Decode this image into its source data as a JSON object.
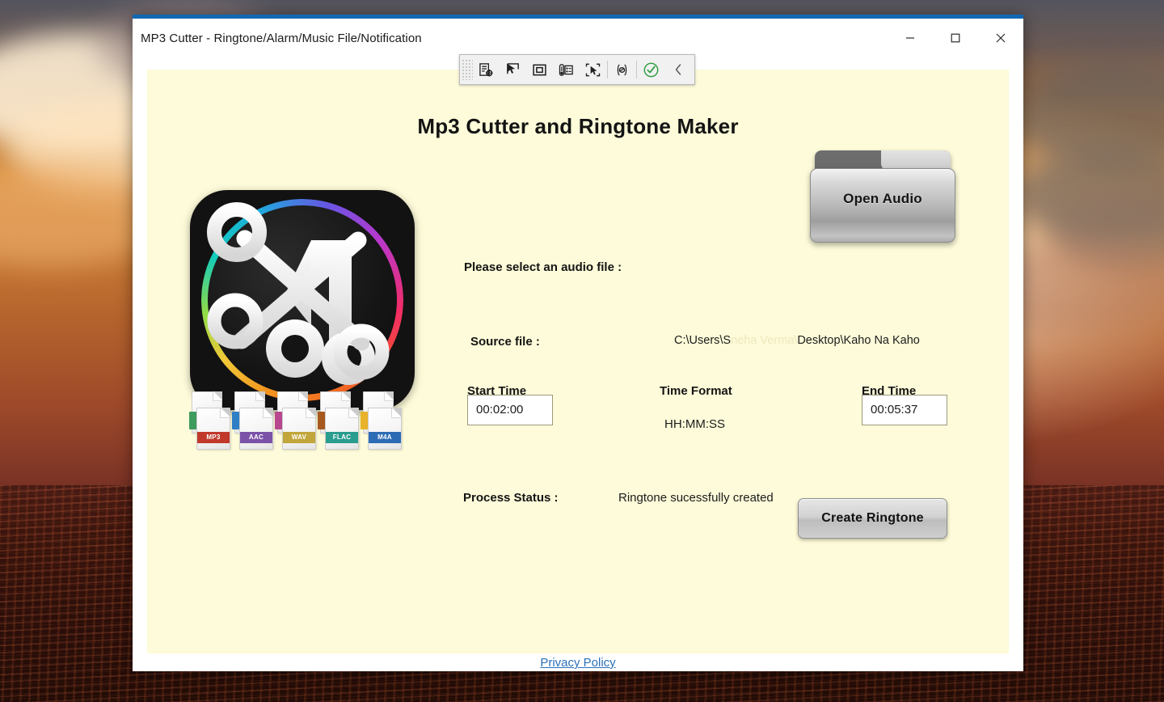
{
  "window": {
    "title": "MP3 Cutter  - Ringtone/Alarm/Music File/Notification",
    "accent_color": "#1268b3",
    "content_bg": "#fdfbd9",
    "controls": {
      "minimize": "Minimize",
      "maximize": "Maximize",
      "close": "Close"
    }
  },
  "dev_toolbar": {
    "items": [
      {
        "name": "drag-grip",
        "label": "Drag handle"
      },
      {
        "name": "inspect-element-icon",
        "label": "Inspect element"
      },
      {
        "name": "pointer-select-icon",
        "label": "Select control"
      },
      {
        "name": "frame-box-icon",
        "label": "Highlight frame"
      },
      {
        "name": "properties-panel-icon",
        "label": "Properties"
      },
      {
        "name": "capture-region-icon",
        "label": "Capture region"
      },
      {
        "name": "code-snippet-icon",
        "label": "{e}"
      },
      {
        "name": "validate-check-icon",
        "label": "Validate"
      },
      {
        "name": "collapse-chevron-icon",
        "label": "Collapse"
      }
    ],
    "check_color": "#2e9c3e"
  },
  "main": {
    "app_title": "Mp3 Cutter and Ringtone Maker",
    "select_prompt": "Please select an audio file :",
    "open_audio_label": "Open Audio",
    "source_label": "Source file :",
    "source_path_prefix": "C:\\Users\\S",
    "source_path_masked": "neha Verma\\",
    "source_path_suffix": "Desktop\\Kaho Na Kaho",
    "start_time_label": "Start Time",
    "start_time_value": "00:02:00",
    "time_format_label": "Time Format",
    "time_format_value": "HH:MM:SS",
    "end_time_label": "End Time",
    "end_time_value": "00:05:37",
    "process_status_label": "Process Status :",
    "process_status_value": "Ringtone sucessfully created",
    "create_button_label": "Create Ringtone",
    "privacy_link_label": " Privacy Policy"
  },
  "format_icons": [
    {
      "ext": "MP3",
      "color": "#c0392b",
      "tab_color": "#3d9c5e"
    },
    {
      "ext": "AAC",
      "color": "#7b52a8",
      "tab_color": "#2f7fc4"
    },
    {
      "ext": "WAV",
      "color": "#c2a63c",
      "tab_color": "#b8478f"
    },
    {
      "ext": "FLAC",
      "color": "#2a9d8f",
      "tab_color": "#a8591f"
    },
    {
      "ext": "M4A",
      "color": "#2d6cb5",
      "tab_color": "#e8b22a"
    }
  ],
  "logo": {
    "name": "mp3-cutter-app-logo",
    "description": "Black rounded square with white scissors over a music note, encircled by a rainbow ring",
    "ring_colors": [
      "#ff9a1f",
      "#ffd23a",
      "#9ae84a",
      "#13d6c4",
      "#1db7e8",
      "#6d5bf0",
      "#c23bd8",
      "#ff2f6e",
      "#ff5a28"
    ]
  }
}
